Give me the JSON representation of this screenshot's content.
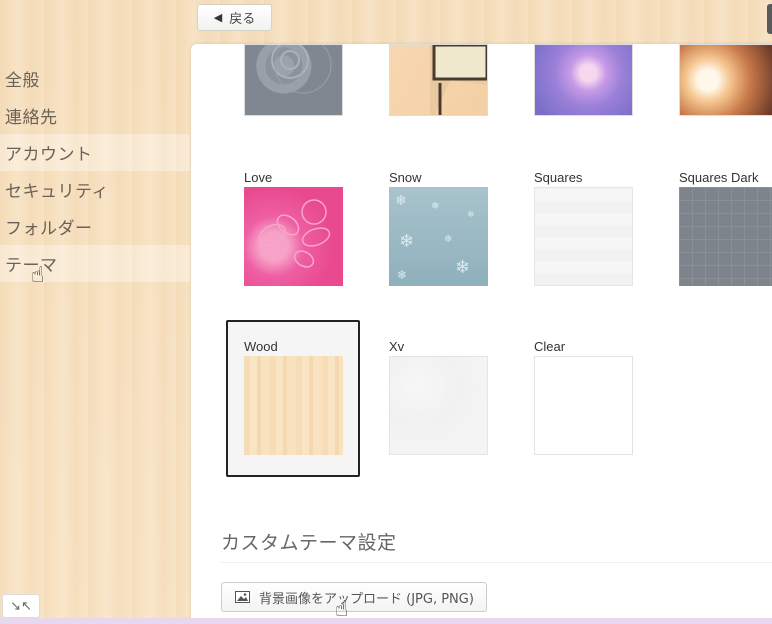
{
  "toolbar": {
    "back_label": "戻る"
  },
  "sidebar": {
    "items": [
      {
        "label": "全般"
      },
      {
        "label": "連絡先"
      },
      {
        "label": "アカウント"
      },
      {
        "label": "セキュリティ"
      },
      {
        "label": "フォルダー"
      },
      {
        "label": "テーマ"
      }
    ]
  },
  "themes": [
    {
      "name": "",
      "style": "dark-circles"
    },
    {
      "name": "",
      "style": "room"
    },
    {
      "name": "",
      "style": "bokeh-purple"
    },
    {
      "name": "",
      "style": "warm-light"
    },
    {
      "name": "Love",
      "style": "love"
    },
    {
      "name": "Snow",
      "style": "snow"
    },
    {
      "name": "Squares",
      "style": "squares"
    },
    {
      "name": "Squares Dark",
      "style": "squares-dark"
    },
    {
      "name": "Wood",
      "style": "wood",
      "selected": true
    },
    {
      "name": "Xv",
      "style": "xv"
    },
    {
      "name": "Clear",
      "style": "clear"
    }
  ],
  "custom_theme": {
    "title": "カスタムテーマ設定",
    "upload_label": "背景画像をアップロード (JPG, PNG)"
  }
}
